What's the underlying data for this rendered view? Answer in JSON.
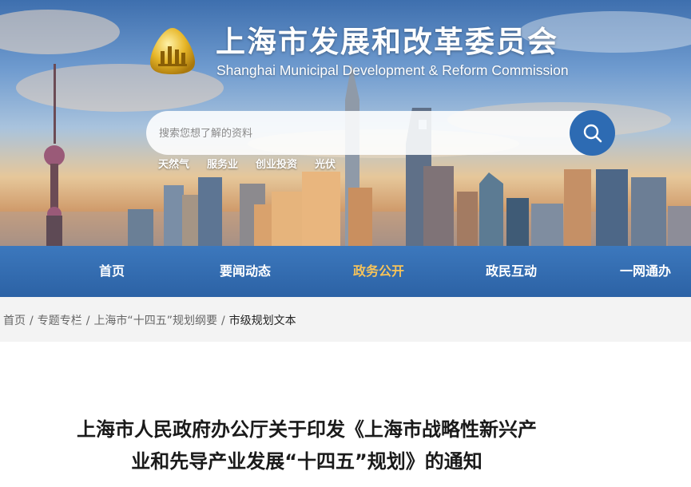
{
  "site": {
    "title": "上海市发展和改革委员会",
    "subtitle": "Shanghai Municipal Development & Reform Commission"
  },
  "search": {
    "placeholder": "搜索您想了解的资料",
    "button_icon": "search-icon",
    "hot_keywords": [
      "天然气",
      "服务业",
      "创业投资",
      "光伏"
    ]
  },
  "nav": {
    "items": [
      {
        "label": "首页",
        "active": false
      },
      {
        "label": "要闻动态",
        "active": false
      },
      {
        "label": "政务公开",
        "active": true
      },
      {
        "label": "政民互动",
        "active": false
      },
      {
        "label": "一网通办",
        "active": false
      }
    ]
  },
  "breadcrumb": {
    "items": [
      "首页",
      "专题专栏",
      "上海市“十四五”规划纲要",
      "市级规划文本"
    ],
    "separator": "/"
  },
  "article": {
    "title_line1": "上海市人民政府办公厅关于印发《上海市战略性新兴产",
    "title_line2": "业和先导产业发展“十四五”规划》的通知"
  },
  "colors": {
    "nav_bg": "#2c62a5",
    "nav_active": "#f6c35a",
    "search_button": "#2d6bb3",
    "breadcrumb_bg": "#f3f3f3"
  }
}
